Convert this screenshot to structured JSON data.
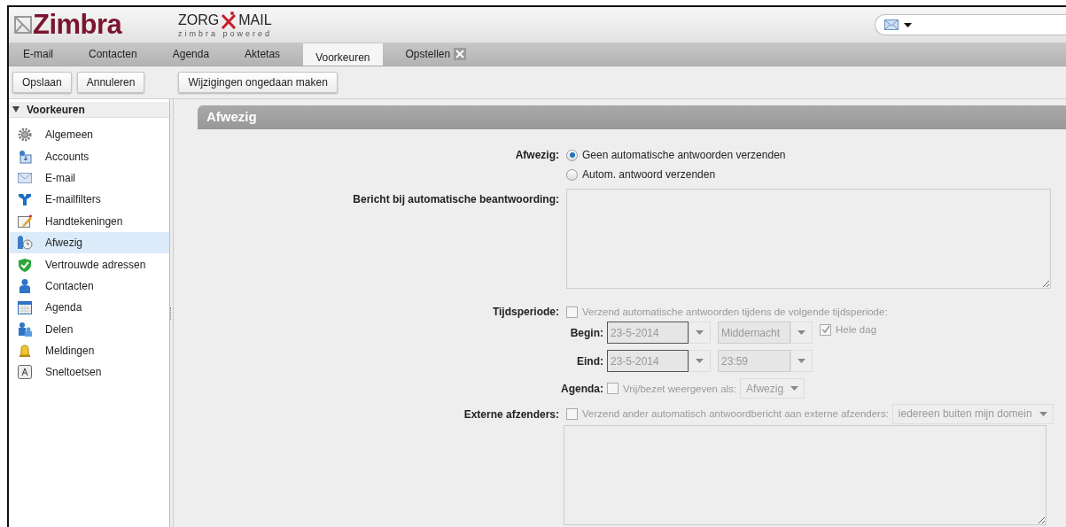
{
  "header": {
    "logo": "Zimbra",
    "brand_left": "ZORG",
    "brand_right": "MAIL",
    "tagline": "zimbra powered"
  },
  "tabs": [
    {
      "label": "E-mail",
      "selected": false,
      "closable": false
    },
    {
      "label": "Contacten",
      "selected": false,
      "closable": false
    },
    {
      "label": "Agenda",
      "selected": false,
      "closable": false
    },
    {
      "label": "Aktetas",
      "selected": false,
      "closable": false
    },
    {
      "label": "Voorkeuren",
      "selected": true,
      "closable": false
    },
    {
      "label": "Opstellen",
      "selected": false,
      "closable": true
    }
  ],
  "toolbar": {
    "buttons": [
      "Opslaan",
      "Annuleren"
    ],
    "undo_button": "Wijzigingen ongedaan maken"
  },
  "sidebar": {
    "title": "Voorkeuren",
    "expanded": true,
    "items": [
      {
        "label": "Algemeen",
        "kind": "gear",
        "selected": false
      },
      {
        "label": "Accounts",
        "kind": "account",
        "selected": false
      },
      {
        "label": "E-mail",
        "kind": "mail",
        "selected": false
      },
      {
        "label": "E-mailfilters",
        "kind": "filter",
        "selected": false
      },
      {
        "label": "Handtekeningen",
        "kind": "signature",
        "selected": false
      },
      {
        "label": "Afwezig",
        "kind": "away",
        "selected": true
      },
      {
        "label": "Vertrouwde adressen",
        "kind": "shield",
        "selected": false
      },
      {
        "label": "Contacten",
        "kind": "person",
        "selected": false
      },
      {
        "label": "Agenda",
        "kind": "calendar",
        "selected": false
      },
      {
        "label": "Delen",
        "kind": "share",
        "selected": false
      },
      {
        "label": "Meldingen",
        "kind": "bell",
        "selected": false
      },
      {
        "label": "Sneltoetsen",
        "kind": "key",
        "selected": false
      }
    ]
  },
  "panel": {
    "title": "Afwezig",
    "away": {
      "label": "Afwezig:",
      "options": [
        {
          "label": "Geen automatische antwoorden verzenden",
          "selected": true
        },
        {
          "label": "Autom. antwoord verzenden",
          "selected": false
        }
      ]
    },
    "message": {
      "label": "Bericht bij automatische beantwoording:"
    },
    "period": {
      "label": "Tijdsperiode:",
      "disabled": true,
      "checkbox": {
        "label": "Verzend automatische antwoorden tijdens de volgende tijdsperiode:",
        "checked": false
      },
      "begin": {
        "label": "Begin:",
        "date": "23-5-2014",
        "time": "Middernacht"
      },
      "end": {
        "label": "Eind:",
        "date": "23-5-2014",
        "time": "23:59"
      },
      "all_day": {
        "label": "Hele dag",
        "checked": true
      }
    },
    "agenda": {
      "label": "Agenda:",
      "disabled": true,
      "checkbox": {
        "label": "Vrij/bezet weergeven als:",
        "checked": false
      },
      "value": "Afwezig"
    },
    "external": {
      "label": "Externe afzenders:",
      "disabled": true,
      "checkbox": {
        "label": "Verzend ander automatisch antwoordbericht aan externe afzenders:",
        "checked": false
      },
      "value": "iedereen buiten mijn domein"
    }
  }
}
